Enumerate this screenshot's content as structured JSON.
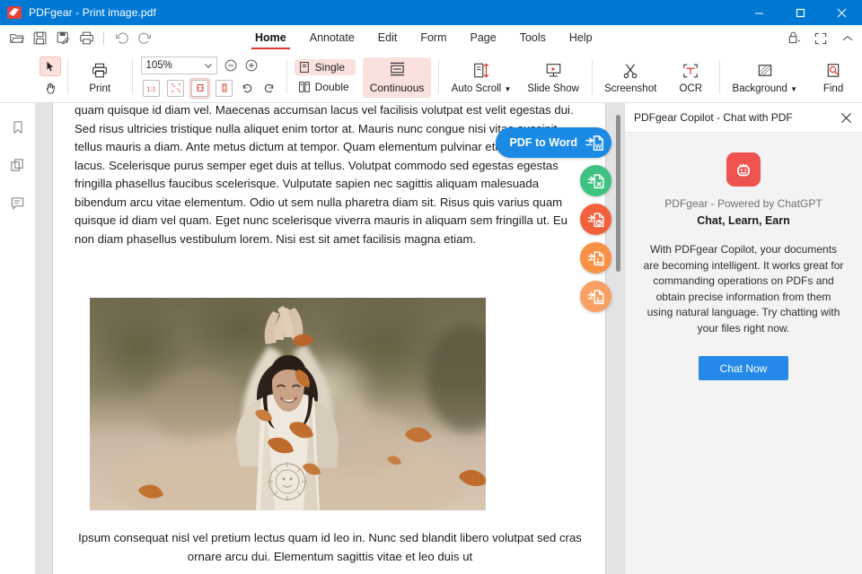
{
  "window": {
    "title": "PDFgear - Print image.pdf",
    "logo_icon": "pdfgear-logo-icon",
    "minimize_label": "Minimize",
    "maximize_label": "Maximize",
    "close_label": "Close",
    "titlebar_color": "#0078d4"
  },
  "quickbar": [
    {
      "name": "open",
      "icon": "folder-open-icon",
      "label": "Open"
    },
    {
      "name": "save",
      "icon": "save-icon",
      "label": "Save"
    },
    {
      "name": "save-as",
      "icon": "save-edit-icon",
      "label": "Save As"
    },
    {
      "name": "print",
      "icon": "printer-icon",
      "label": "Print"
    },
    {
      "name": "undo",
      "icon": "undo-icon",
      "label": "Undo"
    },
    {
      "name": "redo",
      "icon": "redo-icon",
      "label": "Redo"
    }
  ],
  "menubar": {
    "items": [
      {
        "label": "Home",
        "active": true
      },
      {
        "label": "Annotate",
        "active": false
      },
      {
        "label": "Edit",
        "active": false
      },
      {
        "label": "Form",
        "active": false
      },
      {
        "label": "Page",
        "active": false
      },
      {
        "label": "Tools",
        "active": false
      },
      {
        "label": "Help",
        "active": false
      }
    ],
    "active_underline_color": "#e03a2f",
    "right_actions": [
      {
        "name": "share",
        "icon": "share-upload-icon",
        "label": "Share"
      },
      {
        "name": "fullscreen",
        "icon": "fullscreen-icon",
        "label": "Full Screen"
      },
      {
        "name": "collapse-ribbon",
        "icon": "chevron-up-icon",
        "label": "Collapse Ribbon"
      }
    ]
  },
  "ribbon": {
    "select_tool": {
      "icon": "cursor-arrow-icon",
      "label": "Select",
      "selected": true
    },
    "hand_tool": {
      "icon": "hand-icon",
      "label": "Hand",
      "selected": false
    },
    "print": {
      "icon": "printer-icon",
      "label": "Print"
    },
    "zoom": {
      "value": "105%",
      "dropdown_icon": "chevron-down-icon",
      "zoom_out_icon": "minus-circle-icon",
      "zoom_in_icon": "plus-circle-icon",
      "fit_buttons": [
        {
          "name": "actual-size",
          "icon": "actual-size-icon",
          "selected": false
        },
        {
          "name": "fit-page",
          "icon": "fit-page-icon",
          "selected": false
        },
        {
          "name": "fit-width",
          "icon": "fit-width-icon",
          "selected": true
        },
        {
          "name": "fit-visible",
          "icon": "fit-visible-icon",
          "selected": false
        }
      ],
      "rotate_right_icon": "rotate-right-icon",
      "rotate_left_icon": "rotate-left-icon"
    },
    "page_layout": {
      "single": {
        "label": "Single",
        "icon": "single-page-icon",
        "selected": true
      },
      "double": {
        "label": "Double",
        "icon": "double-page-icon",
        "selected": false
      },
      "continuous": {
        "label": "Continuous",
        "icon": "continuous-page-icon",
        "selected": true
      }
    },
    "commands": [
      {
        "label": "Auto Scroll",
        "icon": "auto-scroll-icon",
        "caret": true
      },
      {
        "label": "Slide Show",
        "icon": "slideshow-icon",
        "caret": false
      },
      {
        "label": "Screenshot",
        "icon": "scissors-icon",
        "caret": false
      },
      {
        "label": "OCR",
        "icon": "ocr-icon",
        "caret": false
      },
      {
        "label": "Background",
        "icon": "background-icon",
        "caret": true
      },
      {
        "label": "Find",
        "icon": "find-search-icon",
        "caret": false
      }
    ],
    "selected_highlight_color": "#fbe1dd"
  },
  "left_rail": [
    {
      "name": "bookmarks",
      "icon": "bookmark-icon",
      "label": "Bookmarks"
    },
    {
      "name": "thumbnails",
      "icon": "pages-copy-icon",
      "label": "Page Thumbnails"
    },
    {
      "name": "comments",
      "icon": "comment-icon",
      "label": "Comments"
    }
  ],
  "document": {
    "paragraph_top": "quam quisque id diam vel. Maecenas accumsan lacus vel facilisis volutpat est velit egestas dui. Sed risus ultricies tristique nulla aliquet enim tortor at. Mauris nunc congue nisi vitae suscipit tellus mauris a diam. Ante metus dictum at tempor. Quam elementum pulvinar etiam non quam lacus. Scelerisque purus semper eget duis at tellus. Volutpat commodo sed egestas egestas fringilla phasellus faucibus scelerisque. Vulputate sapien nec sagittis aliquam malesuada bibendum arcu vitae elementum. Odio ut sem nulla pharetra diam sit. Risus quis varius quam quisque id diam vel quam. Eget nunc scelerisque viverra mauris in aliquam sem fringilla ut. Eu non diam phasellus vestibulum lorem. Nisi est sit amet facilisis magna etiam.",
    "image_alt": "Smiling woman with raised arms among falling autumn leaves in a park",
    "paragraph_bottom": "Ipsum consequat nisl vel pretium lectus quam id leo in. Nunc sed blandit libero volutpat sed cras ornare arcu dui. Elementum sagittis vitae et leo duis ut"
  },
  "conversion_fabs": [
    {
      "name": "pdf-to-word",
      "label": "PDF to Word",
      "icon": "word-doc-icon",
      "color": "#1a8ae5",
      "type": "pill"
    },
    {
      "name": "pdf-to-excel",
      "label": "PDF to Excel",
      "icon": "excel-doc-icon",
      "color": "#3ec282",
      "type": "circle"
    },
    {
      "name": "pdf-to-ppt",
      "label": "PDF to PowerPoint",
      "icon": "ppt-doc-icon",
      "color": "#f2613c",
      "type": "circle"
    },
    {
      "name": "pdf-to-image",
      "label": "PDF to Image",
      "icon": "image-doc-icon",
      "color": "#f89145",
      "type": "circle"
    },
    {
      "name": "pdf-to-image-2",
      "label": "PDF to Image",
      "icon": "image-doc-icon",
      "color": "#f9a164",
      "type": "circle"
    }
  ],
  "copilot": {
    "title": "PDFgear Copilot - Chat with PDF",
    "close_icon": "close-icon",
    "logo_icon": "copilot-bot-icon",
    "logo_color": "#ef5350",
    "subtitle": "PDFgear - Powered by ChatGPT",
    "slogan": "Chat, Learn, Earn",
    "description": "With PDFgear Copilot, your documents are becoming intelligent. It works great for commanding operations on PDFs and obtain precise information from them using natural language. Try chatting with your files right now.",
    "cta_label": "Chat Now",
    "cta_color": "#2489e8"
  }
}
